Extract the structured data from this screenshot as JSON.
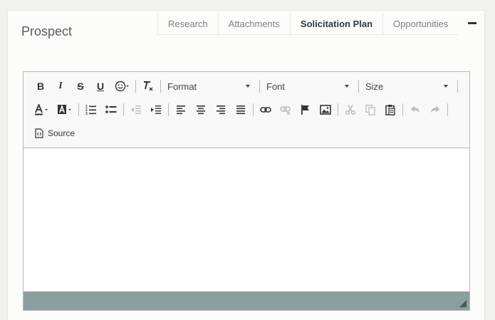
{
  "panel": {
    "title": "Prospect",
    "tabs": [
      {
        "label": "Research",
        "active": false
      },
      {
        "label": "Attachments",
        "active": false
      },
      {
        "label": "Solicitation Plan",
        "active": true
      },
      {
        "label": "Opportunities",
        "active": false
      }
    ]
  },
  "toolbar": {
    "format_label": "Format",
    "font_label": "Font",
    "size_label": "Size",
    "source_label": "Source",
    "bold_label": "B",
    "italic_label": "I",
    "strike_label": "S",
    "underline_label": "U"
  },
  "colors": {
    "status_bar": "#8b9ea0",
    "active_tab": "#2f3a42"
  }
}
